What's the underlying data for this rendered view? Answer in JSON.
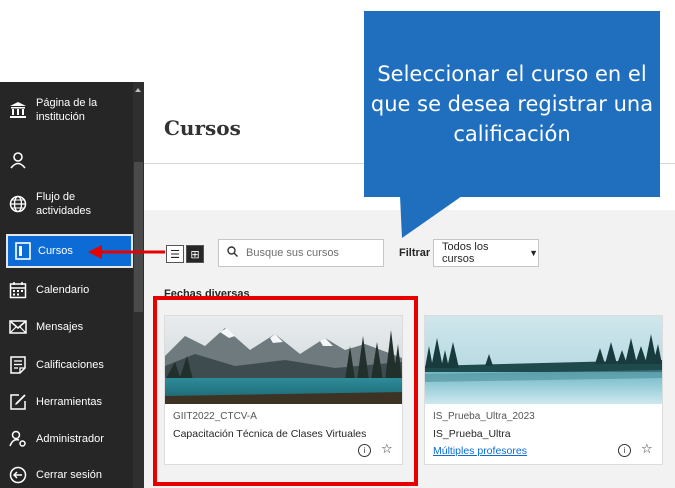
{
  "sidebar": {
    "items": [
      {
        "label": "Página de la institución",
        "icon": "institution-icon"
      },
      {
        "label": "",
        "icon": "profile-icon"
      },
      {
        "label": "Flujo de actividades",
        "icon": "globe-icon"
      },
      {
        "label": "Cursos",
        "icon": "courses-icon",
        "active": true
      },
      {
        "label": "Calendario",
        "icon": "calendar-icon"
      },
      {
        "label": "Mensajes",
        "icon": "envelope-icon"
      },
      {
        "label": "Calificaciones",
        "icon": "grades-icon"
      },
      {
        "label": "Herramientas",
        "icon": "tools-icon"
      },
      {
        "label": "Administrador",
        "icon": "admin-icon"
      },
      {
        "label": "Cerrar sesión",
        "icon": "logout-icon"
      }
    ]
  },
  "main": {
    "title": "Cursos",
    "search_placeholder": "Busque sus cursos",
    "filter_label": "Filtrar",
    "filter_value": "Todos los cursos",
    "group_title": "Fechas diversas",
    "cards": [
      {
        "id": "GIIT2022_CTCV-A",
        "name": "Capacitación Técnica de Clases Virtuales",
        "professors": ""
      },
      {
        "id": "IS_Prueba_Ultra_2023",
        "name": "IS_Prueba_Ultra",
        "professors": "Múltiples profesores"
      }
    ]
  },
  "callout": {
    "text": "Seleccionar el curso en el que se desea registrar una calificación"
  },
  "colors": {
    "sidebar_bg": "#262626",
    "active_blue": "#0d6bd6",
    "callout_blue": "#1f6fbe",
    "highlight_red": "#e60000"
  }
}
